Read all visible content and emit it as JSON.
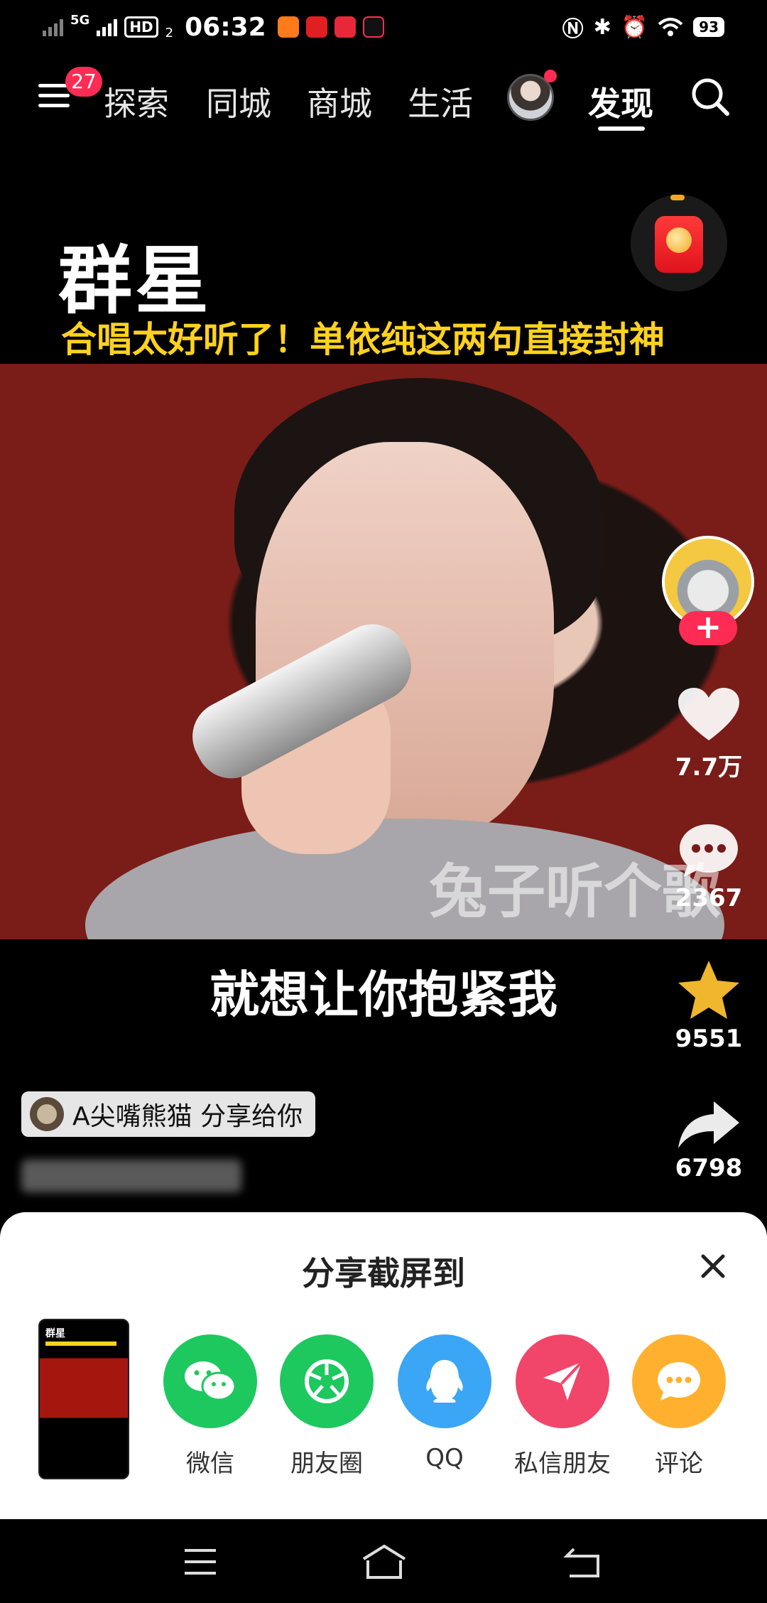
{
  "status_bar": {
    "network": "5G",
    "hd": "HD",
    "hd_sub": "2",
    "time": "06:32",
    "battery": "93"
  },
  "top_nav": {
    "notification_count": "27",
    "tabs": [
      "探索",
      "同城",
      "商城",
      "生活",
      "发现"
    ],
    "active_tab": "发现"
  },
  "video": {
    "title": "群星",
    "subtitle": "合唱太好听了！单依纯这两句直接封神",
    "watermark": "兔子听个歌",
    "caption": "就想让你抱紧我"
  },
  "actions": {
    "follow": "+",
    "likes": "7.7万",
    "comments": "2367",
    "favorites": "9551",
    "shares": "6798"
  },
  "share_info": {
    "text": "A尖嘴熊猫 分享给你"
  },
  "share_sheet": {
    "title": "分享截屏到",
    "thumb_title": "群星",
    "options": [
      {
        "label": "微信",
        "icon": "wechat-icon",
        "color": "#1dc85f"
      },
      {
        "label": "朋友圈",
        "icon": "moments-icon",
        "color": "#1dc85f"
      },
      {
        "label": "QQ",
        "icon": "qq-icon",
        "color": "#3aa6f5"
      },
      {
        "label": "私信朋友",
        "icon": "send-icon",
        "color": "#f2456a"
      },
      {
        "label": "评论",
        "icon": "comment-icon",
        "color": "#ffb02e"
      }
    ]
  },
  "colors": {
    "accent": "#fe2c55",
    "subtitle": "#ffd21e",
    "star": "#f0b62d"
  }
}
